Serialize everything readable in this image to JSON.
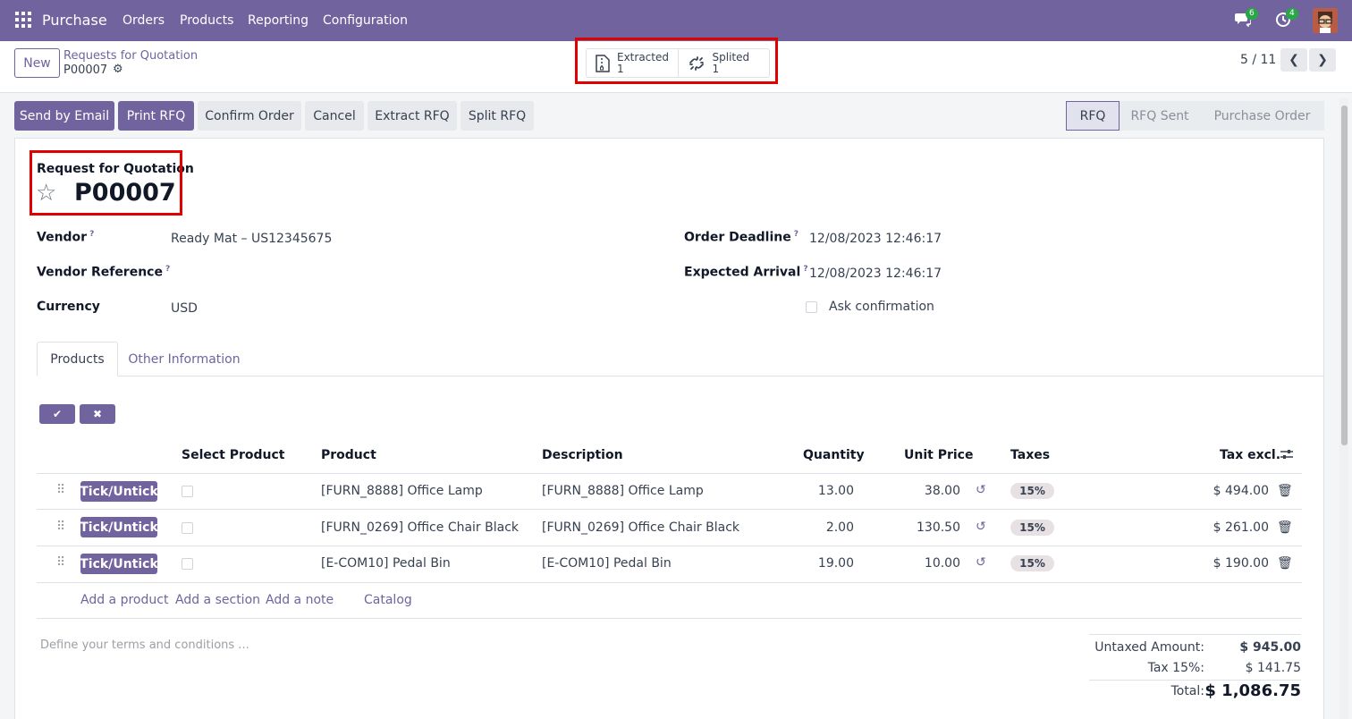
{
  "topbar": {
    "app_name": "Purchase",
    "menu": [
      "Orders",
      "Products",
      "Reporting",
      "Configuration"
    ],
    "messages_count": "6",
    "activities_count": "4"
  },
  "control": {
    "new_label": "New",
    "breadcrumb_parent": "Requests for Quotation",
    "breadcrumb_current": "P00007",
    "smart_buttons": [
      {
        "label": "Extracted",
        "count": "1",
        "icon": "file-zip-icon"
      },
      {
        "label": "Splited",
        "count": "1",
        "icon": "unlink-icon"
      }
    ],
    "pager": "5 / 11"
  },
  "actions": [
    "Send by Email",
    "Print RFQ",
    "Confirm Order",
    "Cancel",
    "Extract RFQ",
    "Split RFQ"
  ],
  "statusbar": [
    "RFQ",
    "RFQ Sent",
    "Purchase Order"
  ],
  "form": {
    "subtitle": "Request for Quotation",
    "title": "P00007",
    "vendor_label": "Vendor",
    "vendor_value": "Ready Mat – US12345675",
    "vendor_ref_label": "Vendor Reference",
    "currency_label": "Currency",
    "currency_value": "USD",
    "deadline_label": "Order Deadline",
    "deadline_value": "12/08/2023 12:46:17",
    "arrival_label": "Expected Arrival",
    "arrival_value": "12/08/2023 12:46:17",
    "ask_confirmation": "Ask confirmation",
    "help_mark": "?"
  },
  "tabs": [
    "Products",
    "Other Information"
  ],
  "table": {
    "headers": [
      "Select Product",
      "Product",
      "Description",
      "Quantity",
      "Unit Price",
      "Taxes",
      "Tax excl."
    ],
    "tick_label": "Tick/Untick",
    "rows": [
      {
        "product": "[FURN_8888] Office Lamp",
        "description": "[FURN_8888] Office Lamp",
        "quantity": "13.00",
        "unit_price": "38.00",
        "tax": "15%",
        "subtotal": "$ 494.00"
      },
      {
        "product": "[FURN_0269] Office Chair Black",
        "description": "[FURN_0269] Office Chair Black",
        "quantity": "2.00",
        "unit_price": "130.50",
        "tax": "15%",
        "subtotal": "$ 261.00"
      },
      {
        "product": "[E-COM10] Pedal Bin",
        "description": "[E-COM10] Pedal Bin",
        "quantity": "19.00",
        "unit_price": "10.00",
        "tax": "15%",
        "subtotal": "$ 190.00"
      }
    ],
    "add_links": [
      "Add a product",
      "Add a section",
      "Add a note",
      "Catalog"
    ]
  },
  "terms_placeholder": "Define your terms and conditions ...",
  "totals": {
    "untaxed_label": "Untaxed Amount:",
    "untaxed_value": "$ 945.00",
    "tax_label": "Tax 15%:",
    "tax_value": "$ 141.75",
    "total_label": "Total:",
    "total_value": "$ 1,086.75"
  },
  "colors": {
    "brand": "#71639e",
    "highlight_box": "#e00000"
  }
}
